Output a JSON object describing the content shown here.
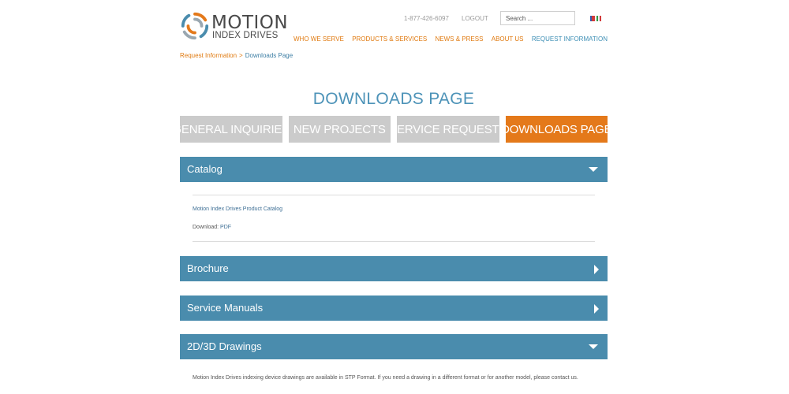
{
  "header": {
    "logo_line1": "MOTION",
    "logo_line2": "INDEX DRIVES",
    "phone": "1-877-426-6097",
    "logout": "LOGOUT",
    "search_placeholder": "Search ...",
    "flags": [
      "us-flag",
      "it-flag"
    ]
  },
  "nav": {
    "items": [
      "WHO WE SERVE",
      "PRODUCTS & SERVICES",
      "NEWS & PRESS",
      "ABOUT US",
      "REQUEST INFORMATION"
    ]
  },
  "breadcrumb": {
    "parent": "Request Information",
    "separator": ">",
    "current": "Downloads Page"
  },
  "page_title": "DOWNLOADS PAGE",
  "tabs": [
    {
      "label": "GENERAL INQUIRIES",
      "active": false
    },
    {
      "label": "NEW PROJECTS",
      "active": false
    },
    {
      "label": "SERVICE REQUESTS",
      "active": false
    },
    {
      "label": "DOWNLOADS PAGE",
      "active": true
    }
  ],
  "sections": [
    {
      "label": "Catalog",
      "expanded": true
    },
    {
      "label": "Brochure",
      "expanded": false
    },
    {
      "label": "Service Manuals",
      "expanded": false
    },
    {
      "label": "2D/3D Drawings",
      "expanded": true
    }
  ],
  "catalog": {
    "item_title": "Motion Index Drives Product Catalog",
    "download_label": "Download:",
    "download_link": "PDF"
  },
  "drawings": {
    "text": "Motion Index Drives indexing device drawings are available in STP Format. If you need a drawing in a different format or for another model, please contact us."
  },
  "colors": {
    "accent_orange": "#e4791a",
    "accent_blue": "#4a8cad",
    "tab_inactive": "#cbcbcb"
  }
}
